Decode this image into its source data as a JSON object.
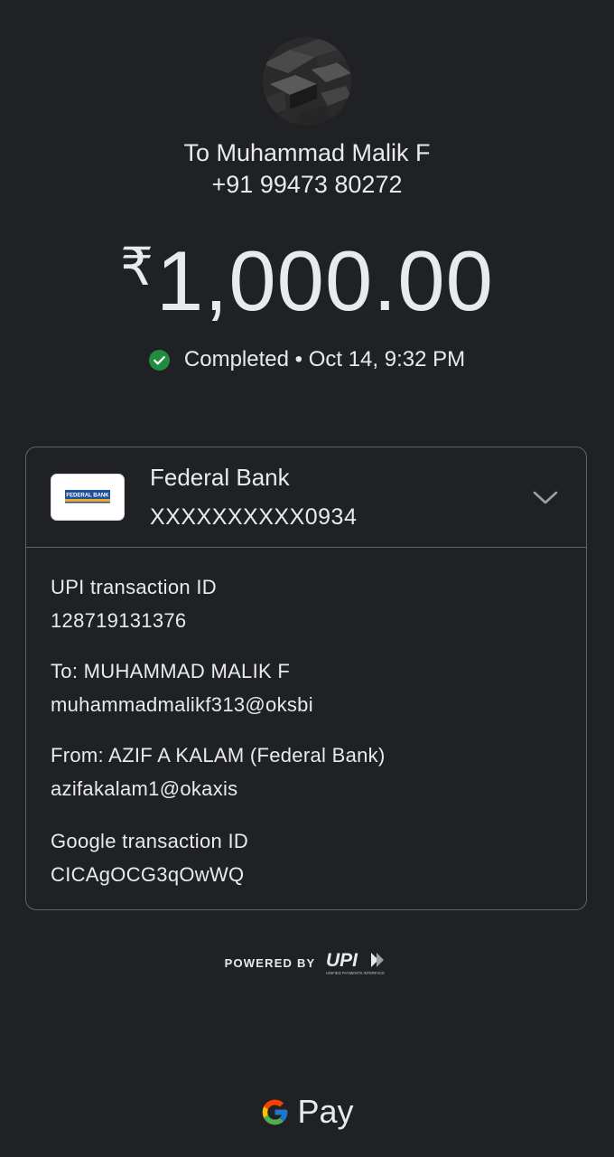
{
  "recipient": {
    "name": "To Muhammad Malik F",
    "phone": "+91 99473 80272"
  },
  "payment": {
    "currency_symbol": "₹",
    "amount": "1,000.00",
    "status_text": "Completed • Oct 14, 9:32 PM",
    "status_color": "#1e8e3e"
  },
  "bank": {
    "name": "Federal Bank",
    "account": "XXXXXXXXXX0934",
    "logo_text": "FEDERAL BANK"
  },
  "details": [
    {
      "label": "UPI transaction ID",
      "value": "128719131376"
    },
    {
      "label": "To: MUHAMMAD MALIK F",
      "value": "muhammadmalikf313@oksbi"
    },
    {
      "label": "From: AZIF A KALAM (Federal Bank)",
      "value": "azifakalam1@okaxis"
    },
    {
      "label": "Google transaction ID",
      "value": "CICAgOCG3qOwWQ"
    }
  ],
  "footer": {
    "powered_by": "POWERED BY",
    "upi_logo_text": "UPI",
    "upi_tagline": "UNIFIED PAYMENTS INTERFACE",
    "brand": "Pay"
  },
  "icons": {
    "status": "check-circle-icon",
    "expand": "chevron-down-icon",
    "brand": "google-g-icon"
  }
}
